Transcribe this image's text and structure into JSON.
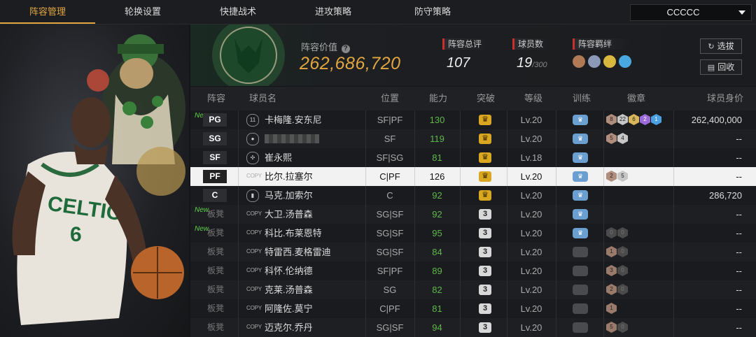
{
  "nav": {
    "tabs": [
      {
        "label": "阵容管理",
        "active": true
      },
      {
        "label": "轮换设置",
        "active": false
      },
      {
        "label": "快捷战术",
        "active": false
      },
      {
        "label": "进攻策略",
        "active": false
      },
      {
        "label": "防守策略",
        "active": false
      }
    ],
    "user_selector": "CCCCC"
  },
  "header": {
    "lineup_value_label": "阵容价值",
    "help_icon": "question-icon",
    "lineup_value": "262,686,720",
    "overall_label": "阵容总评",
    "overall_value": "107",
    "player_count_label": "球员数",
    "player_count": "19",
    "player_count_max": "/300",
    "bond_label": "阵容羁绊",
    "select_btn": "选拔",
    "recycle_btn": "回收"
  },
  "columns": {
    "lineup": "阵容",
    "name": "球员名",
    "position": "位置",
    "ability": "能力",
    "breakthrough": "突破",
    "level": "等级",
    "training": "训练",
    "badges": "徽章",
    "value": "球员身价"
  },
  "rows": [
    {
      "slot": "PG",
      "is_starter": true,
      "new": "New",
      "card": "11",
      "name": "卡梅隆.安东尼",
      "position": "SF|PF",
      "ability": "130",
      "ability_green": true,
      "break": "crown",
      "level": "Lv.20",
      "train": true,
      "badges": [
        [
          "brz",
          "8"
        ],
        [
          "slv",
          "22"
        ],
        [
          "gld",
          "6"
        ],
        [
          "pur",
          "2"
        ],
        [
          "blu",
          "1"
        ]
      ],
      "value": "262,400,000"
    },
    {
      "slot": "SG",
      "is_starter": true,
      "new": "",
      "card": "person",
      "name": "",
      "blurred": true,
      "position": "SF",
      "ability": "119",
      "ability_green": true,
      "break": "crown",
      "level": "Lv.20",
      "train": true,
      "badges": [
        [
          "brz",
          "5"
        ],
        [
          "slv",
          "4"
        ]
      ],
      "value": "--"
    },
    {
      "slot": "SF",
      "is_starter": true,
      "new": "",
      "card": "leaf",
      "name": "崔永熙",
      "position": "SF|SG",
      "ability": "81",
      "ability_green": true,
      "break": "crown",
      "level": "Lv.18",
      "train": true,
      "badges": [],
      "value": "--"
    },
    {
      "slot": "PF",
      "is_starter": true,
      "selected": true,
      "new": "",
      "card": "copy",
      "name": "比尔.拉塞尔",
      "position": "C|PF",
      "ability": "126",
      "ability_green": false,
      "break": "crown",
      "level": "Lv.20",
      "train": true,
      "badges": [
        [
          "brz",
          "2"
        ],
        [
          "slv",
          "5"
        ]
      ],
      "value": "--"
    },
    {
      "slot": "C",
      "is_starter": true,
      "new": "",
      "card": "bars",
      "name": "马克.加索尔",
      "position": "C",
      "ability": "92",
      "ability_green": true,
      "break": "crown",
      "level": "Lv.20",
      "train": true,
      "badges": [],
      "value": "286,720"
    },
    {
      "slot": "板凳",
      "is_starter": false,
      "new": "New",
      "card": "copy",
      "name": "大卫.汤普森",
      "position": "SG|SF",
      "ability": "92",
      "ability_green": true,
      "break": "3",
      "level": "Lv.20",
      "train": true,
      "badges": [],
      "value": "--"
    },
    {
      "slot": "板凳",
      "is_starter": false,
      "new": "New",
      "card": "copy",
      "name": "科比.布莱恩特",
      "position": "SG|SF",
      "ability": "95",
      "ability_green": true,
      "break": "3",
      "level": "Lv.20",
      "train": true,
      "badges": [
        [
          "dim",
          "0"
        ],
        [
          "dim",
          "0"
        ]
      ],
      "value": "--"
    },
    {
      "slot": "板凳",
      "is_starter": false,
      "new": "",
      "card": "copy",
      "name": "特雷西.麦格雷迪",
      "position": "SG|SF",
      "ability": "84",
      "ability_green": true,
      "break": "3",
      "level": "Lv.20",
      "train": false,
      "badges": [
        [
          "brzd",
          "1"
        ],
        [
          "dim",
          "0"
        ]
      ],
      "value": "--"
    },
    {
      "slot": "板凳",
      "is_starter": false,
      "new": "",
      "card": "copy",
      "name": "科怀.伦纳德",
      "position": "SF|PF",
      "ability": "89",
      "ability_green": true,
      "break": "3",
      "level": "Lv.20",
      "train": false,
      "badges": [
        [
          "brzd",
          "3"
        ],
        [
          "dim",
          "0"
        ]
      ],
      "value": "--"
    },
    {
      "slot": "板凳",
      "is_starter": false,
      "new": "",
      "card": "copy",
      "name": "克莱.汤普森",
      "position": "SG",
      "ability": "82",
      "ability_green": true,
      "break": "3",
      "level": "Lv.20",
      "train": false,
      "badges": [
        [
          "brzd",
          "2"
        ],
        [
          "dim",
          "0"
        ]
      ],
      "value": "--"
    },
    {
      "slot": "板凳",
      "is_starter": false,
      "new": "",
      "card": "copy",
      "name": "阿隆佐.莫宁",
      "position": "C|PF",
      "ability": "81",
      "ability_green": true,
      "break": "3",
      "level": "Lv.20",
      "train": false,
      "badges": [
        [
          "brzd",
          "1"
        ]
      ],
      "value": "--"
    },
    {
      "slot": "板凳",
      "is_starter": false,
      "new": "",
      "card": "copy",
      "name": "迈克尔.乔丹",
      "position": "SG|SF",
      "ability": "94",
      "ability_green": true,
      "break": "3",
      "level": "Lv.20",
      "train": false,
      "badges": [
        [
          "brzd",
          "5"
        ],
        [
          "dim",
          "0"
        ]
      ],
      "value": "--"
    }
  ],
  "colors": {
    "accent": "#e2a640",
    "green": "#5fb84a",
    "red_marker": "#c9302c"
  }
}
